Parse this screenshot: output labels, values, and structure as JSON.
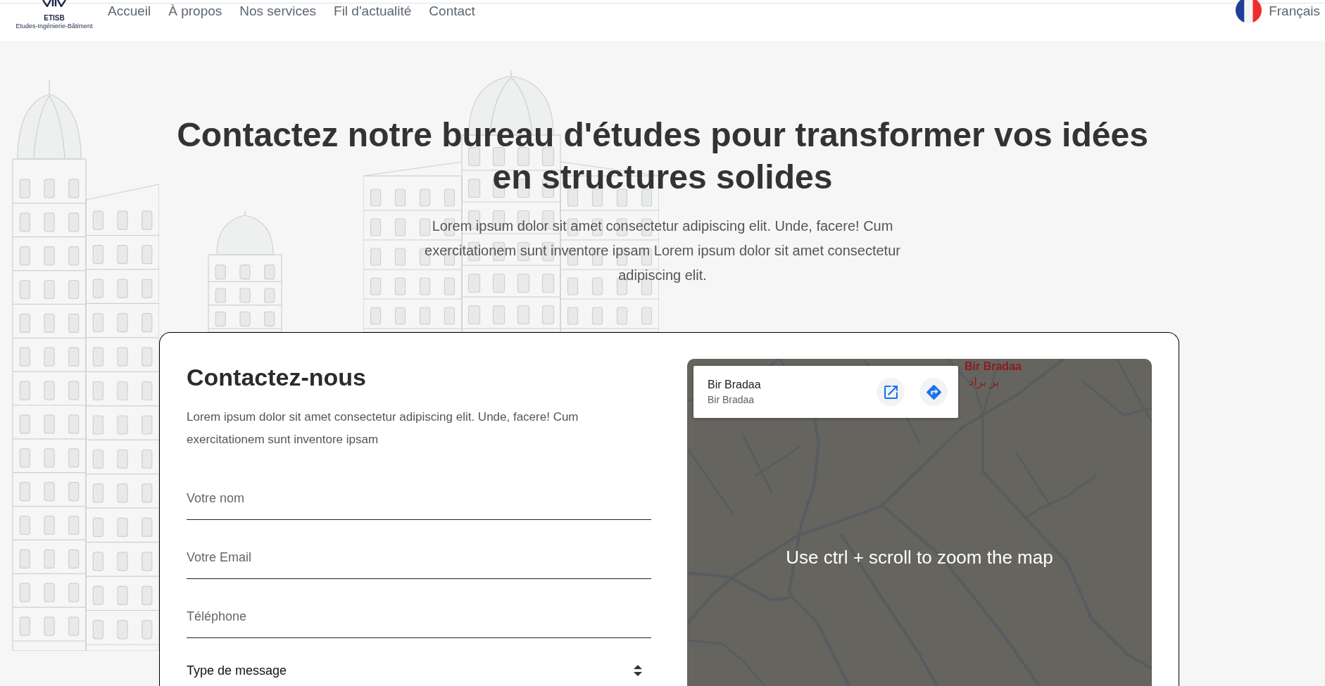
{
  "nav": {
    "logo": {
      "name": "ETISB",
      "tagline": "Etudes-Ingénierie-Bâtiment"
    },
    "links": [
      {
        "label": "Accueil"
      },
      {
        "label": "À propos"
      },
      {
        "label": "Nos services"
      },
      {
        "label": "Fil d'actualité"
      },
      {
        "label": "Contact"
      }
    ],
    "language": {
      "label": "Français"
    }
  },
  "hero": {
    "title": "Contactez notre bureau d'études pour transformer vos idées en structures solides",
    "subtitle": "Lorem ipsum dolor sit amet consectetur adipiscing elit. Unde, facere! Cum exercitationem sunt inventore ipsam Lorem ipsum dolor sit amet consectetur adipiscing elit."
  },
  "contact": {
    "title": "Contactez-nous",
    "text": "Lorem ipsum dolor sit amet consectetur adipiscing elit. Unde, facere! Cum exercitationem sunt inventore ipsam",
    "fields": [
      {
        "kind": "input",
        "placeholder": "Votre nom"
      },
      {
        "kind": "input",
        "placeholder": "Votre Email"
      },
      {
        "kind": "input",
        "placeholder": "Téléphone"
      },
      {
        "kind": "select",
        "value": "Type de message"
      }
    ]
  },
  "map": {
    "place": {
      "title": "Bir Bradaa",
      "subtitle": "Bir Bradaa"
    },
    "labels": [
      "Bir Bradaa",
      "بر براد"
    ],
    "hint": "Use ctrl + scroll to zoom the map"
  }
}
